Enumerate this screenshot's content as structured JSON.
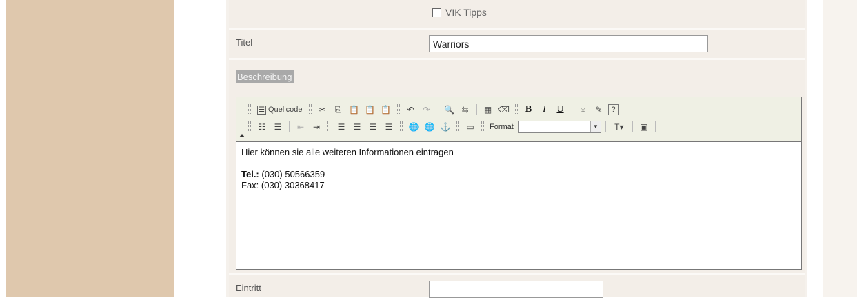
{
  "form": {
    "checkbox_vik": {
      "label": "VIK Tipps",
      "checked": false
    },
    "titel": {
      "label": "Titel",
      "value": "Warriors"
    },
    "beschreibung": {
      "label": "Beschreibung"
    },
    "eintritt": {
      "label": "Eintritt",
      "value": ""
    }
  },
  "editor": {
    "toolbar": {
      "source_label": "Quellcode",
      "format_label": "Format",
      "format_value": ""
    },
    "content": {
      "intro": "Hier können sie alle weiteren Informationen eintragen",
      "tel_label": "Tel.:",
      "tel_value": " (030) 50566359",
      "fax_line": "Fax: (030) 30368417"
    }
  },
  "colors": {
    "left_panel": "#dfc8ad",
    "form_background": "#f3eee8",
    "toolbar_background": "#eff0e4"
  }
}
